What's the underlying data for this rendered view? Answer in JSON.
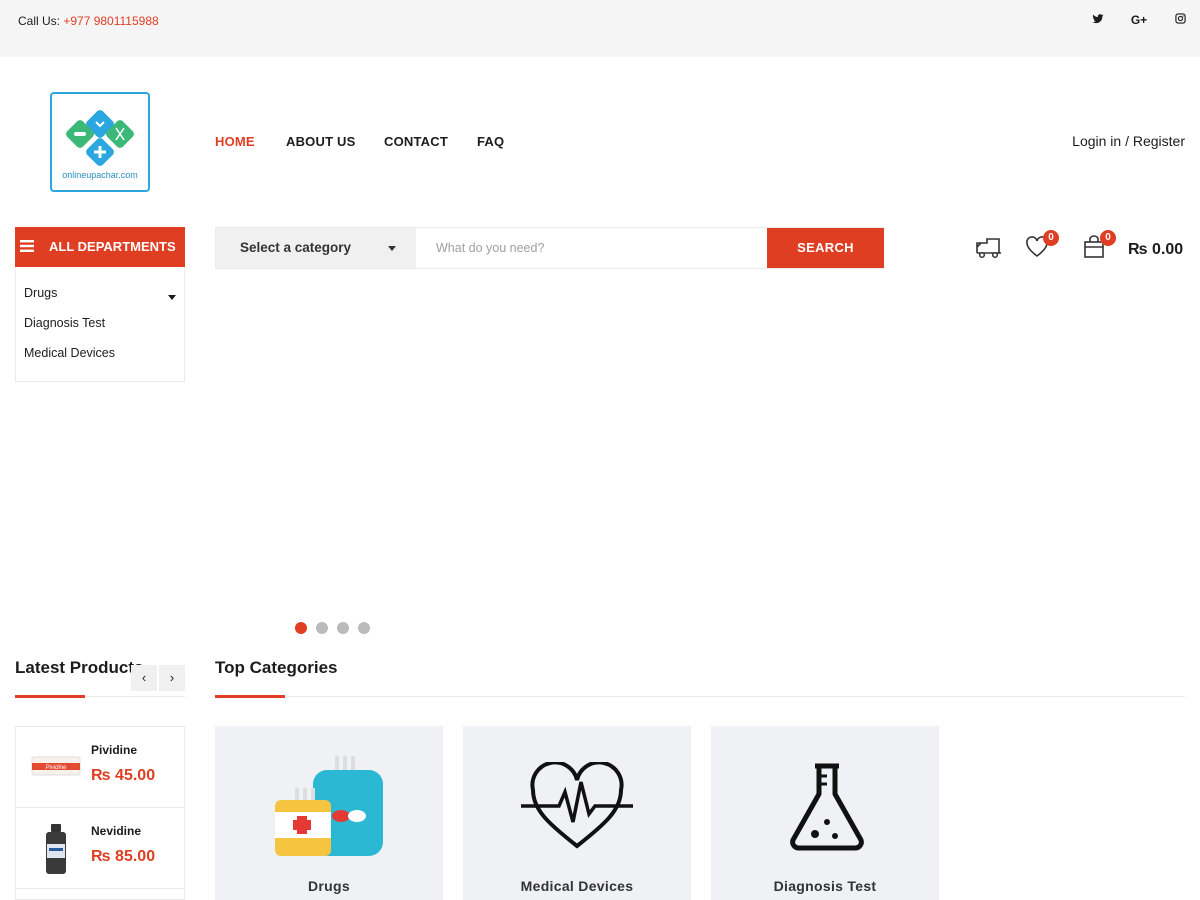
{
  "topbar": {
    "call_label": "Call Us: ",
    "phone": "+977 9801115988",
    "social": [
      {
        "name": "facebook-icon",
        "glyph": ""
      },
      {
        "name": "twitter-icon",
        "glyph": "t"
      },
      {
        "name": "google-plus-icon",
        "glyph": "G+"
      },
      {
        "name": "instagram-icon",
        "glyph": "◎"
      }
    ]
  },
  "logo": {
    "text": "onlineupachar.com"
  },
  "nav": {
    "home": "HOME",
    "about": "ABOUT US",
    "contact": "CONTACT",
    "faq": "FAQ"
  },
  "login": "Login in / Register",
  "departments": {
    "label": "ALL DEPARTMENTS",
    "items": [
      "Drugs",
      "Diagnosis Test",
      "Medical Devices"
    ]
  },
  "search": {
    "category": "Select a category",
    "placeholder": "What do you need?",
    "button": "SEARCH"
  },
  "header_icons": {
    "wishlist_count": "0",
    "cart_count": "0",
    "total": "₨ 0.00"
  },
  "slider": {
    "dot_count": 4,
    "active": 0
  },
  "latest": {
    "title": "Latest Products",
    "prev": "‹",
    "next": "›",
    "products": [
      {
        "name": "Pividine",
        "price": "₨ 45.00"
      },
      {
        "name": "Nevidine",
        "price": "₨ 85.00"
      }
    ]
  },
  "top_categories": {
    "title": "Top Categories",
    "items": [
      "Drugs",
      "Medical Devices",
      "Diagnosis Test"
    ]
  },
  "colors": {
    "accent": "#e03e23",
    "logo_green": "#3cb878",
    "logo_blue": "#2aa7e0"
  }
}
